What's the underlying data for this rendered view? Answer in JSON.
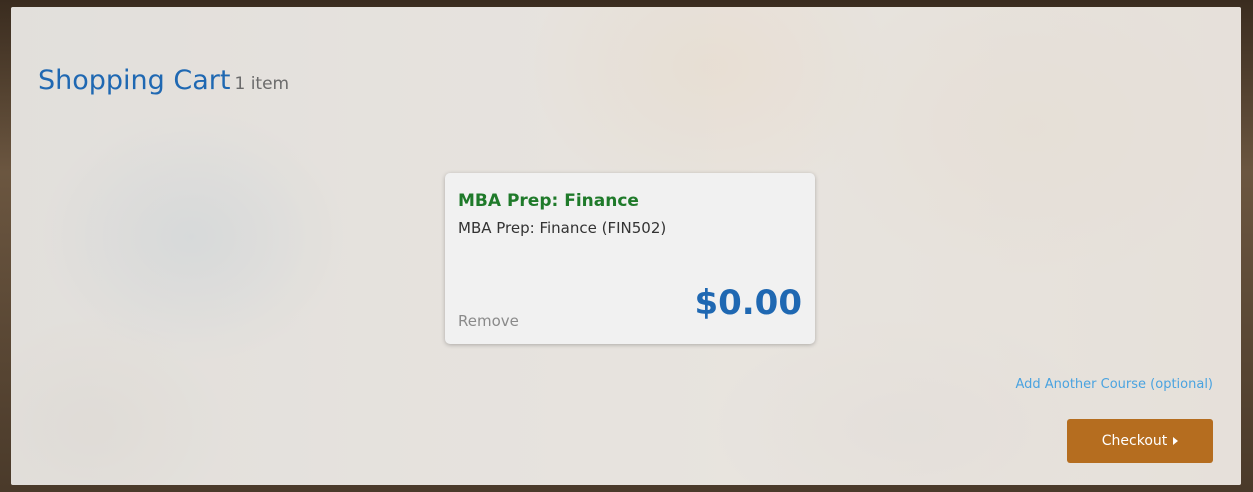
{
  "cart": {
    "title": "Shopping Cart",
    "item_count": "1 item"
  },
  "items": [
    {
      "title": "MBA Prep: Finance",
      "subtitle": "MBA Prep: Finance (FIN502)",
      "remove_label": "Remove",
      "price": "$0.00"
    }
  ],
  "actions": {
    "add_course_label": "Add Another Course (optional)",
    "checkout_label": "Checkout",
    "checkout_icon": "caret-right-icon"
  },
  "colors": {
    "title_blue": "#1f68b2",
    "item_title_green": "#1f7a2a",
    "link_blue": "#4aa3e0",
    "checkout_orange": "#b56d1f"
  }
}
